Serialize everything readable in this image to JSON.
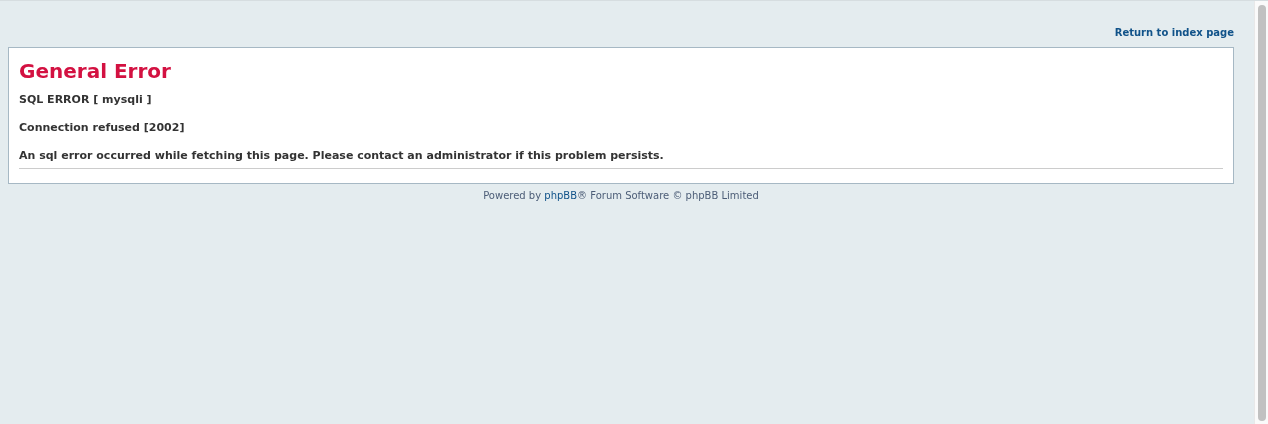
{
  "top_link": "Return to index page",
  "panel": {
    "title": "General Error",
    "lines": [
      "SQL ERROR [ mysqli ]",
      "Connection refused [2002]",
      "An sql error occurred while fetching this page. Please contact an administrator if this problem persists."
    ]
  },
  "footer": {
    "before": "Powered by ",
    "link": "phpBB",
    "after": "® Forum Software © phpBB Limited"
  }
}
